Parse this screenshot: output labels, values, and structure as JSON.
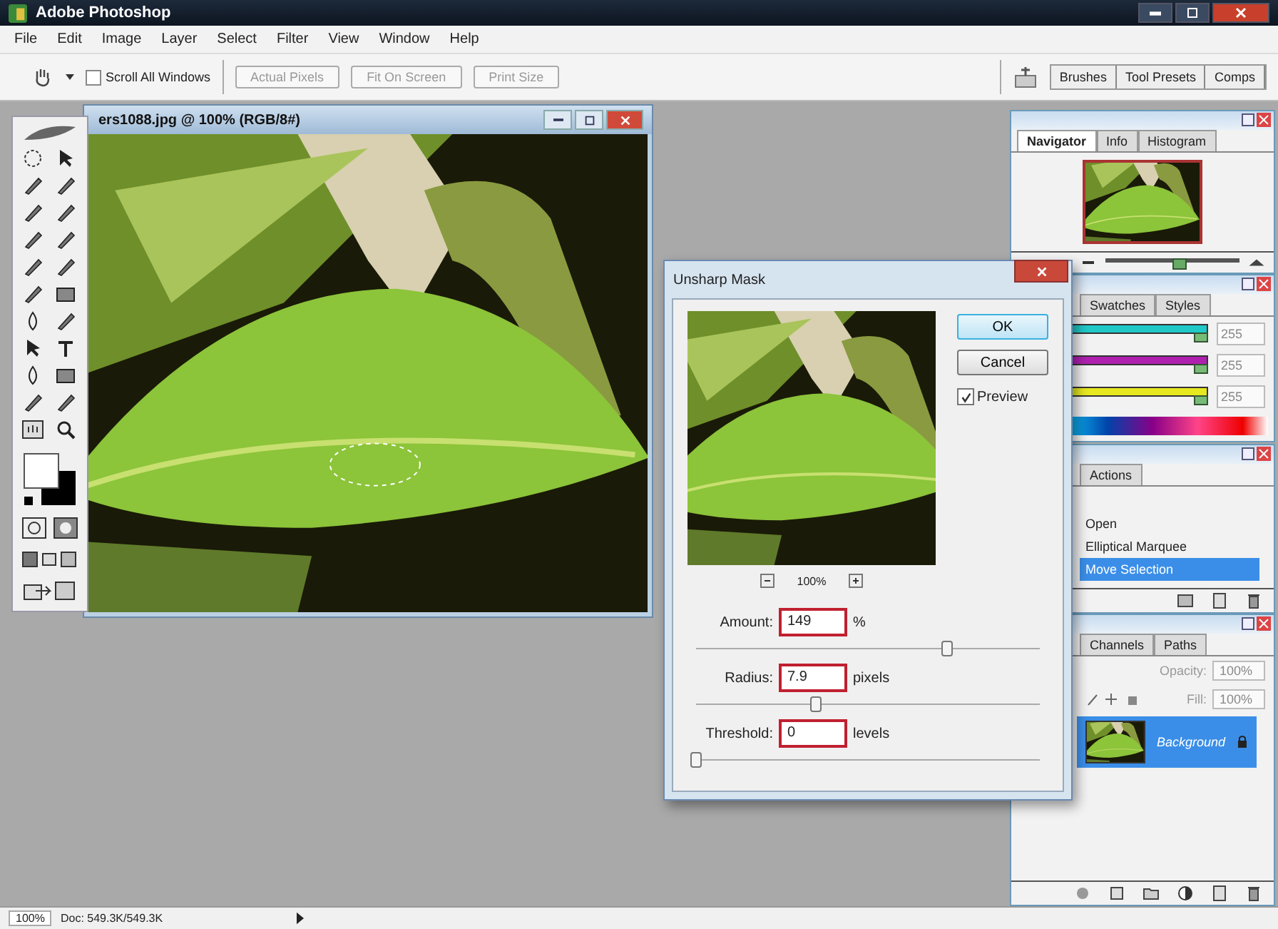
{
  "app": {
    "title": "Adobe Photoshop"
  },
  "menu": [
    "File",
    "Edit",
    "Image",
    "Layer",
    "Select",
    "Filter",
    "View",
    "Window",
    "Help"
  ],
  "options_bar": {
    "scroll_all": {
      "label": "Scroll All Windows",
      "checked": false
    },
    "buttons": [
      {
        "label": "Actual Pixels",
        "disabled": true
      },
      {
        "label": "Fit On Screen",
        "disabled": true
      },
      {
        "label": "Print Size",
        "disabled": true
      }
    ]
  },
  "palette_well": {
    "tabs": [
      "Brushes",
      "Tool Presets",
      "Comps"
    ]
  },
  "document": {
    "title": "ers1088.jpg @ 100% (RGB/8#)"
  },
  "navigator": {
    "tabs": [
      {
        "label": "Navigator",
        "selected": true
      },
      {
        "label": "Info",
        "selected": false
      },
      {
        "label": "Histogram",
        "selected": false
      }
    ],
    "zoom_slider": {
      "level": 0.55
    }
  },
  "color": {
    "tabs": [
      {
        "label": "Swatches",
        "selected": false
      },
      {
        "label": "Styles",
        "selected": false
      }
    ],
    "channels": [
      {
        "color": "#20c8c8",
        "value": "255",
        "level": 1
      },
      {
        "color": "#b020b0",
        "value": "255",
        "level": 1
      },
      {
        "color": "#e8e820",
        "value": "255",
        "level": 1
      }
    ]
  },
  "history": {
    "tabs": [
      {
        "label": "Actions",
        "selected": false
      }
    ],
    "items": [
      {
        "label": "Open",
        "selected": false
      },
      {
        "label": "Elliptical Marquee",
        "selected": false
      },
      {
        "label": "Move Selection",
        "selected": true
      }
    ]
  },
  "layers": {
    "tabs": [
      {
        "label": "Channels",
        "selected": false
      },
      {
        "label": "Paths",
        "selected": false
      }
    ],
    "opacity_label": "Opacity:",
    "opacity": "100%",
    "fill_label": "Fill:",
    "fill": "100%",
    "layers": [
      {
        "name": "Background",
        "selected": true
      }
    ]
  },
  "dialog": {
    "title": "Unsharp Mask",
    "buttons": [
      "OK",
      "Cancel"
    ],
    "preview": {
      "label": "Preview",
      "checked": true
    },
    "zoom": "100%",
    "fields": [
      {
        "label": "Amount:",
        "value": "149",
        "unit": "%",
        "level": 0.73
      },
      {
        "label": "Radius:",
        "value": "7.9",
        "unit": "pixels",
        "level": 0.35
      },
      {
        "label": "Threshold:",
        "value": "0",
        "unit": "levels",
        "level": 0
      }
    ]
  },
  "status_bar": {
    "zoom": "100%",
    "doc": "Doc: 549.3K/549.3K"
  }
}
